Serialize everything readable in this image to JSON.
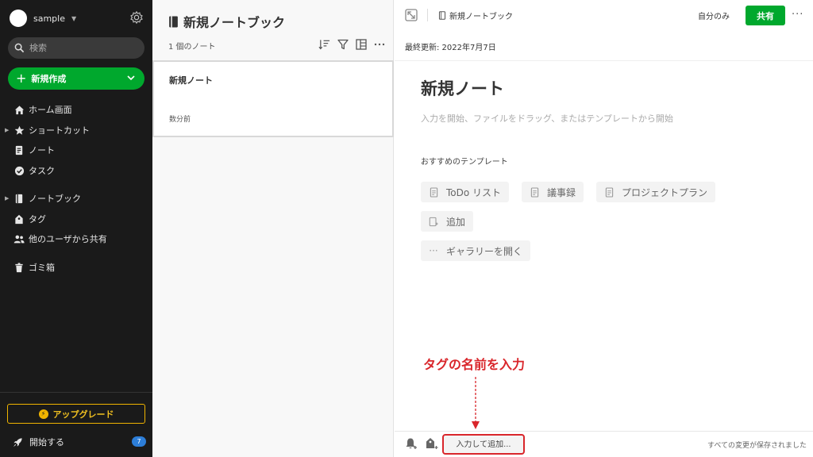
{
  "sidebar": {
    "account_name": "sample",
    "search_placeholder": "検索",
    "new_button": "新規作成",
    "nav": {
      "home": "ホーム画面",
      "shortcuts": "ショートカット",
      "notes": "ノート",
      "tasks": "タスク",
      "notebooks": "ノートブック",
      "tags": "タグ",
      "shared": "他のユーザから共有",
      "trash": "ゴミ箱"
    },
    "upgrade": "アップグレード",
    "get_started": "開始する",
    "get_started_badge": "7"
  },
  "notelist": {
    "title": "新規ノートブック",
    "count": "1 個のノート",
    "note": {
      "title": "新規ノート",
      "time": "数分前"
    }
  },
  "editor": {
    "breadcrumb": "新規ノートブック",
    "visibility": "自分のみ",
    "share": "共有",
    "more": "···",
    "last_updated": "最終更新: 2022年7月7日",
    "title": "新規ノート",
    "body_placeholder": "入力を開始、ファイルをドラッグ、またはテンプレートから開始",
    "templates_heading": "おすすめのテンプレート",
    "templates": {
      "todo": "ToDo リスト",
      "minutes": "議事録",
      "project": "プロジェクトプラン",
      "add": "追加",
      "gallery": "ギャラリーを開く"
    },
    "tag_placeholder": "入力して追加...",
    "saved_status": "すべての変更が保存されました"
  },
  "annotation": {
    "callout": "タグの名前を入力"
  },
  "colors": {
    "green": "#00a82d",
    "sidebar": "#1a1a1a",
    "annotation": "#d9262b",
    "upgrade": "#f0b400"
  }
}
